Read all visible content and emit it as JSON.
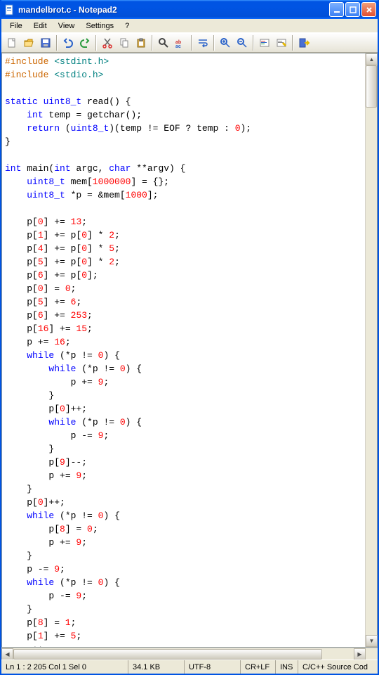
{
  "title": "mandelbrot.c - Notepad2",
  "menu": [
    "File",
    "Edit",
    "View",
    "Settings",
    "?"
  ],
  "toolbar_icons": [
    "new-icon",
    "open-icon",
    "save-icon",
    "sep",
    "undo-icon",
    "redo-icon",
    "sep",
    "cut-icon",
    "copy-icon",
    "paste-icon",
    "sep",
    "find-icon",
    "replace-icon",
    "sep",
    "wordwrap-icon",
    "sep",
    "zoomin-icon",
    "zoomout-icon",
    "sep",
    "scheme-icon",
    "scheme2-icon",
    "sep",
    "exit-icon"
  ],
  "code_tokens": [
    [
      [
        "pp",
        "#include "
      ],
      [
        "st",
        "<stdint.h>"
      ]
    ],
    [
      [
        "pp",
        "#include "
      ],
      [
        "st",
        "<stdio.h>"
      ]
    ],
    [],
    [
      [
        "kw",
        "static"
      ],
      [
        "",
        " "
      ],
      [
        "ty",
        "uint8_t"
      ],
      [
        "",
        " read() {"
      ]
    ],
    [
      [
        "",
        "    "
      ],
      [
        "ty",
        "int"
      ],
      [
        "",
        " temp = getchar();"
      ]
    ],
    [
      [
        "",
        "    "
      ],
      [
        "kw",
        "return"
      ],
      [
        "",
        " ("
      ],
      [
        "ty",
        "uint8_t"
      ],
      [
        "",
        ")(temp != EOF ? temp : "
      ],
      [
        "nu",
        "0"
      ],
      [
        "",
        ");"
      ]
    ],
    [
      [
        "",
        "}"
      ]
    ],
    [],
    [
      [
        "ty",
        "int"
      ],
      [
        "",
        " main("
      ],
      [
        "ty",
        "int"
      ],
      [
        "",
        " argc, "
      ],
      [
        "ty",
        "char"
      ],
      [
        "",
        " **argv) {"
      ]
    ],
    [
      [
        "",
        "    "
      ],
      [
        "ty",
        "uint8_t"
      ],
      [
        "",
        " mem["
      ],
      [
        "nu",
        "1000000"
      ],
      [
        "",
        "] = {};"
      ]
    ],
    [
      [
        "",
        "    "
      ],
      [
        "ty",
        "uint8_t"
      ],
      [
        "",
        " *p = &mem["
      ],
      [
        "nu",
        "1000"
      ],
      [
        "",
        "];"
      ]
    ],
    [],
    [
      [
        "",
        "    p["
      ],
      [
        "nu",
        "0"
      ],
      [
        "",
        "] += "
      ],
      [
        "nu",
        "13"
      ],
      [
        "",
        ";"
      ]
    ],
    [
      [
        "",
        "    p["
      ],
      [
        "nu",
        "1"
      ],
      [
        "",
        "] += p["
      ],
      [
        "nu",
        "0"
      ],
      [
        "",
        "] * "
      ],
      [
        "nu",
        "2"
      ],
      [
        "",
        ";"
      ]
    ],
    [
      [
        "",
        "    p["
      ],
      [
        "nu",
        "4"
      ],
      [
        "",
        "] += p["
      ],
      [
        "nu",
        "0"
      ],
      [
        "",
        "] * "
      ],
      [
        "nu",
        "5"
      ],
      [
        "",
        ";"
      ]
    ],
    [
      [
        "",
        "    p["
      ],
      [
        "nu",
        "5"
      ],
      [
        "",
        "] += p["
      ],
      [
        "nu",
        "0"
      ],
      [
        "",
        "] * "
      ],
      [
        "nu",
        "2"
      ],
      [
        "",
        ";"
      ]
    ],
    [
      [
        "",
        "    p["
      ],
      [
        "nu",
        "6"
      ],
      [
        "",
        "] += p["
      ],
      [
        "nu",
        "0"
      ],
      [
        "",
        "];"
      ]
    ],
    [
      [
        "",
        "    p["
      ],
      [
        "nu",
        "0"
      ],
      [
        "",
        "] = "
      ],
      [
        "nu",
        "0"
      ],
      [
        "",
        ";"
      ]
    ],
    [
      [
        "",
        "    p["
      ],
      [
        "nu",
        "5"
      ],
      [
        "",
        "] += "
      ],
      [
        "nu",
        "6"
      ],
      [
        "",
        ";"
      ]
    ],
    [
      [
        "",
        "    p["
      ],
      [
        "nu",
        "6"
      ],
      [
        "",
        "] += "
      ],
      [
        "nu",
        "253"
      ],
      [
        "",
        ";"
      ]
    ],
    [
      [
        "",
        "    p["
      ],
      [
        "nu",
        "16"
      ],
      [
        "",
        "] += "
      ],
      [
        "nu",
        "15"
      ],
      [
        "",
        ";"
      ]
    ],
    [
      [
        "",
        "    p += "
      ],
      [
        "nu",
        "16"
      ],
      [
        "",
        ";"
      ]
    ],
    [
      [
        "",
        "    "
      ],
      [
        "kw",
        "while"
      ],
      [
        "",
        " (*p != "
      ],
      [
        "nu",
        "0"
      ],
      [
        "",
        ") {"
      ]
    ],
    [
      [
        "",
        "        "
      ],
      [
        "kw",
        "while"
      ],
      [
        "",
        " (*p != "
      ],
      [
        "nu",
        "0"
      ],
      [
        "",
        ") {"
      ]
    ],
    [
      [
        "",
        "            p += "
      ],
      [
        "nu",
        "9"
      ],
      [
        "",
        ";"
      ]
    ],
    [
      [
        "",
        "        }"
      ]
    ],
    [
      [
        "",
        "        p["
      ],
      [
        "nu",
        "0"
      ],
      [
        "",
        "]++;"
      ]
    ],
    [
      [
        "",
        "        "
      ],
      [
        "kw",
        "while"
      ],
      [
        "",
        " (*p != "
      ],
      [
        "nu",
        "0"
      ],
      [
        "",
        ") {"
      ]
    ],
    [
      [
        "",
        "            p -= "
      ],
      [
        "nu",
        "9"
      ],
      [
        "",
        ";"
      ]
    ],
    [
      [
        "",
        "        }"
      ]
    ],
    [
      [
        "",
        "        p["
      ],
      [
        "nu",
        "9"
      ],
      [
        "",
        "]--;"
      ]
    ],
    [
      [
        "",
        "        p += "
      ],
      [
        "nu",
        "9"
      ],
      [
        "",
        ";"
      ]
    ],
    [
      [
        "",
        "    }"
      ]
    ],
    [
      [
        "",
        "    p["
      ],
      [
        "nu",
        "0"
      ],
      [
        "",
        "]++;"
      ]
    ],
    [
      [
        "",
        "    "
      ],
      [
        "kw",
        "while"
      ],
      [
        "",
        " (*p != "
      ],
      [
        "nu",
        "0"
      ],
      [
        "",
        ") {"
      ]
    ],
    [
      [
        "",
        "        p["
      ],
      [
        "nu",
        "8"
      ],
      [
        "",
        "] = "
      ],
      [
        "nu",
        "0"
      ],
      [
        "",
        ";"
      ]
    ],
    [
      [
        "",
        "        p += "
      ],
      [
        "nu",
        "9"
      ],
      [
        "",
        ";"
      ]
    ],
    [
      [
        "",
        "    }"
      ]
    ],
    [
      [
        "",
        "    p -= "
      ],
      [
        "nu",
        "9"
      ],
      [
        "",
        ";"
      ]
    ],
    [
      [
        "",
        "    "
      ],
      [
        "kw",
        "while"
      ],
      [
        "",
        " (*p != "
      ],
      [
        "nu",
        "0"
      ],
      [
        "",
        ") {"
      ]
    ],
    [
      [
        "",
        "        p -= "
      ],
      [
        "nu",
        "9"
      ],
      [
        "",
        ";"
      ]
    ],
    [
      [
        "",
        "    }"
      ]
    ],
    [
      [
        "",
        "    p["
      ],
      [
        "nu",
        "8"
      ],
      [
        "",
        "] = "
      ],
      [
        "nu",
        "1"
      ],
      [
        "",
        ";"
      ]
    ],
    [
      [
        "",
        "    p["
      ],
      [
        "nu",
        "1"
      ],
      [
        "",
        "] += "
      ],
      [
        "nu",
        "5"
      ],
      [
        "",
        ";"
      ]
    ],
    [
      [
        "",
        "    p++;"
      ]
    ]
  ],
  "status": {
    "pos": "Ln 1 : 2 205   Col 1   Sel 0",
    "size": "34.1 KB",
    "enc": "UTF-8",
    "eol": "CR+LF",
    "ovr": "INS",
    "lex": "C/C++ Source Cod"
  }
}
